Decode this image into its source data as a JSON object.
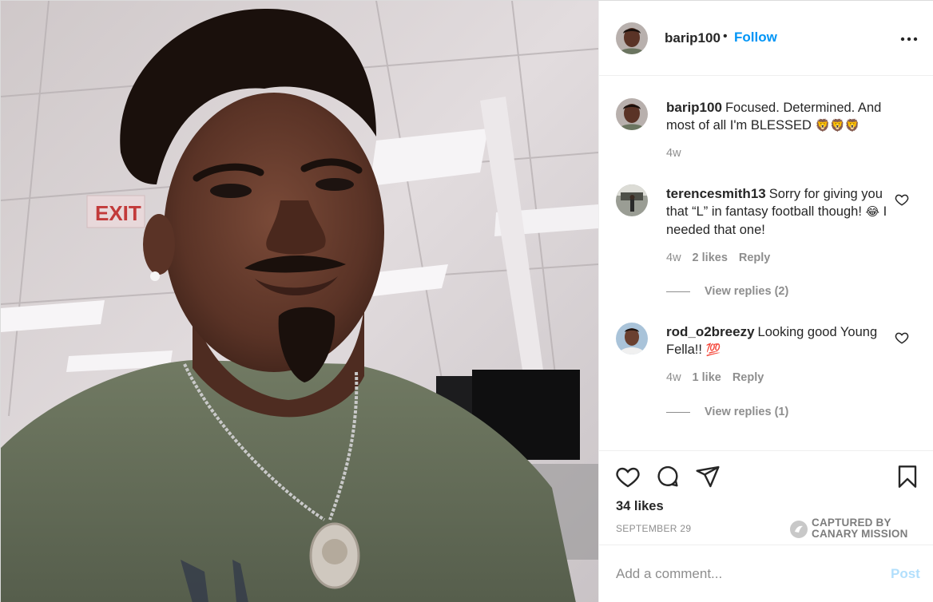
{
  "post": {
    "username": "barip100",
    "dot": "•",
    "follow_label": "Follow",
    "more_icon": "more-horizontal-icon"
  },
  "caption": {
    "username": "barip100",
    "text": "Focused. Determined. And most of all I'm BLESSED",
    "emoji": "🦁🦁🦁",
    "time": "4w"
  },
  "comments": [
    {
      "username": "terencesmith13",
      "text": "Sorry for giving you that “L” in fantasy football though!",
      "emoji": "😂",
      "text_after": "I needed that one!",
      "time": "4w",
      "likes": "2 likes",
      "reply_label": "Reply",
      "view_replies": "View replies (2)"
    },
    {
      "username": "rod_o2breezy",
      "text": "Looking good Young Fella!!",
      "emoji": "💯",
      "time": "4w",
      "likes": "1 like",
      "reply_label": "Reply",
      "view_replies": "View replies (1)"
    }
  ],
  "actions": {
    "likes": "34 likes",
    "date": "SEPTEMBER 29",
    "captured_line1": "CAPTURED BY",
    "captured_line2": "CANARY MISSION"
  },
  "add_comment": {
    "placeholder": "Add a comment...",
    "post_label": "Post"
  },
  "photo": {
    "sign_text": "EXIT"
  },
  "colors": {
    "link": "#0095f6",
    "muted": "#8e8e8e",
    "post_disabled": "#b2dffc",
    "shirt": "#6b7560"
  }
}
